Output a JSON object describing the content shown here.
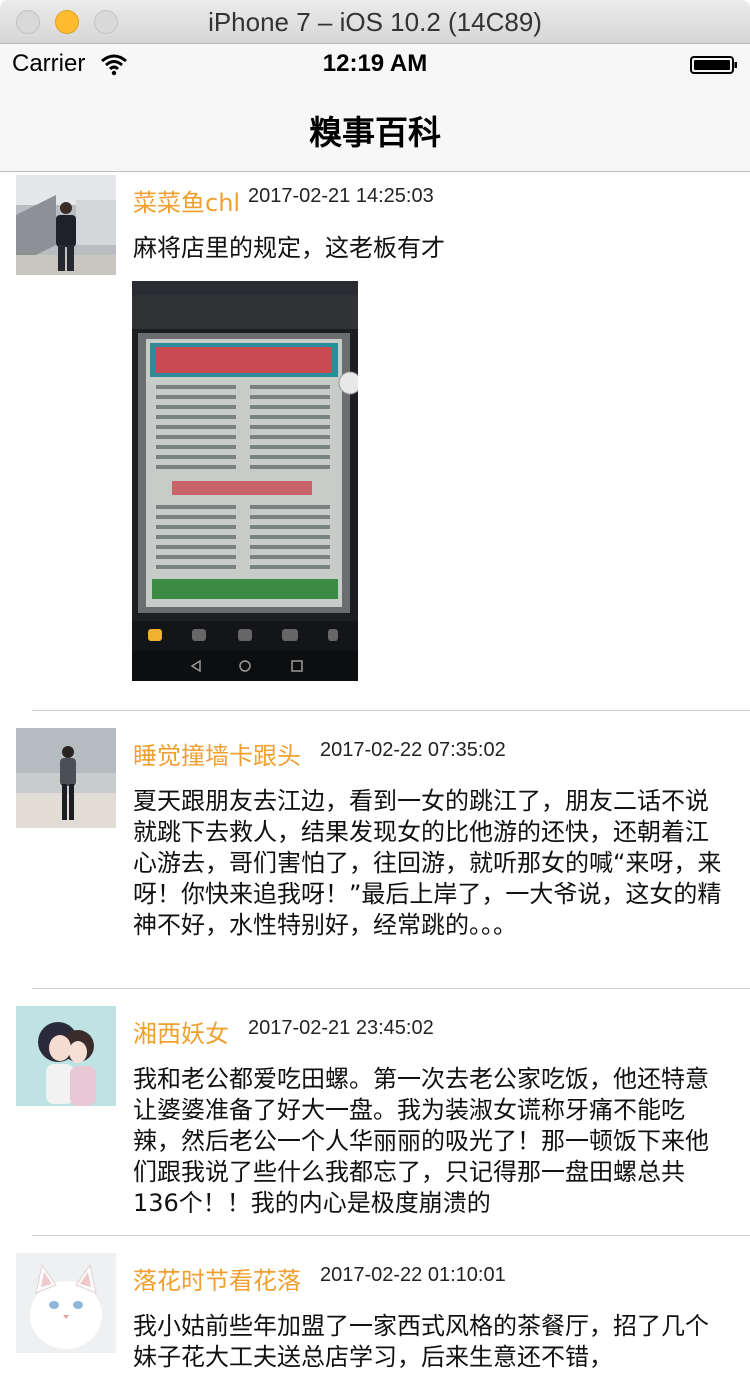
{
  "simulator": {
    "window_title": "iPhone 7 – iOS 10.2 (14C89)"
  },
  "status_bar": {
    "carrier": "Carrier",
    "time": "12:19 AM"
  },
  "nav": {
    "title": "糗事百科"
  },
  "colors": {
    "username": "#f0a030",
    "divider": "#cfcfcf",
    "bar_bg": "#f7f7f7"
  },
  "posts": [
    {
      "username": "菜菜鱼chl",
      "time": "2017-02-21 14:25:03",
      "content": "麻将店里的规定，这老板有才",
      "has_image": true
    },
    {
      "username": "睡觉撞墙卡跟头",
      "time": "2017-02-22 07:35:02",
      "content": "夏天跟朋友去江边，看到一女的跳江了，朋友二话不说就跳下去救人，结果发现女的比他游的还快，还朝着江心游去，哥们害怕了，往回游，就听那女的喊“来呀，来呀！你快来追我呀！”最后上岸了，一大爷说，这女的精神不好，水性特别好，经常跳的。。。"
    },
    {
      "username": "湘西妖女",
      "time": "2017-02-21 23:45:02",
      "content": "我和老公都爱吃田螺。第一次去老公家吃饭，他还特意让婆婆准备了好大一盘。我为装淑女谎称牙痛不能吃辣，然后老公一个人华丽丽的吸光了！那一顿饭下来他们跟我说了些什么我都忘了，只记得那一盘田螺总共136个！！我的内心是极度崩溃的"
    },
    {
      "username": "落花时节看花落",
      "time": "2017-02-22 01:10:01",
      "content": "我小姑前些年加盟了一家西式风格的茶餐厅，招了几个妹子花大工夫送总店学习，后来生意还不错，"
    }
  ]
}
